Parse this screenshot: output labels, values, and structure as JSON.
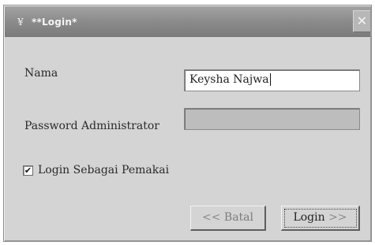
{
  "window": {
    "title": "**Login*",
    "icon": "app-icon",
    "close_glyph": "✕"
  },
  "form": {
    "nama_label": "Nama",
    "nama_value": "Keysha Najwa",
    "password_label": "Password Administrator",
    "password_value": "",
    "checkbox_label": "Login Sebagai Pemakai",
    "checkbox_checked": true,
    "checkbox_mark": "✔"
  },
  "buttons": {
    "batal_arrows": "<<",
    "batal_label": "Batal",
    "login_label": "Login",
    "login_arrows": ">>"
  }
}
